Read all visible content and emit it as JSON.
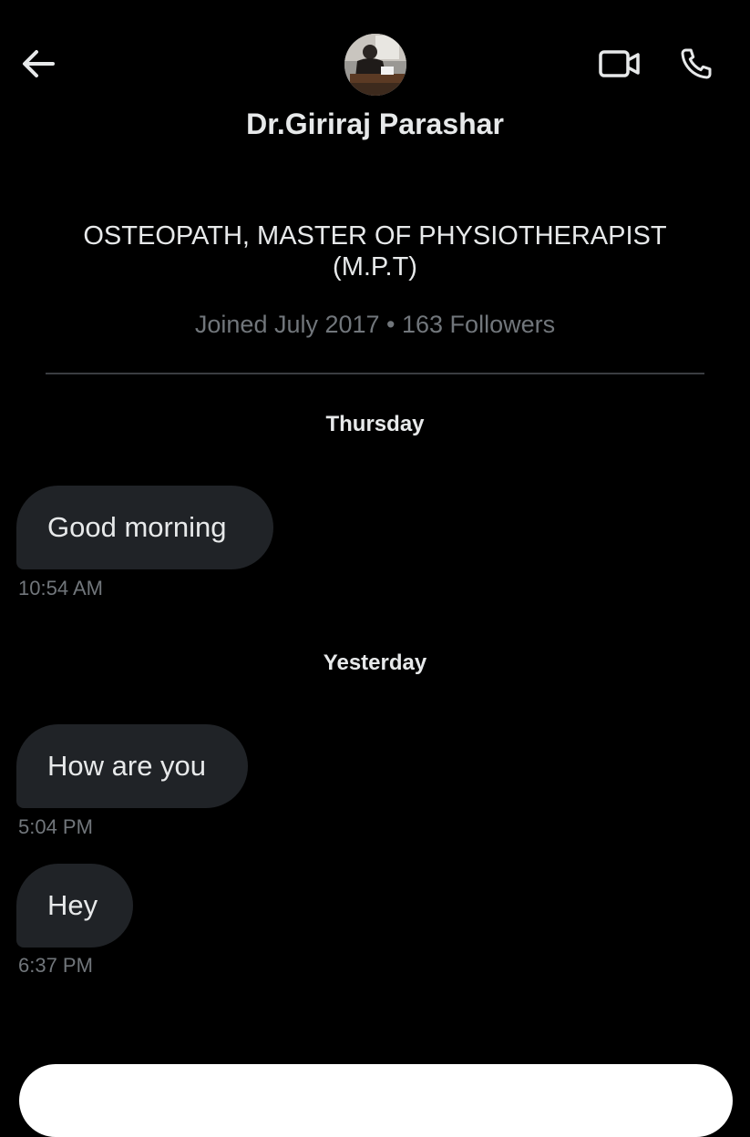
{
  "header": {
    "back_icon": "arrow-left-icon",
    "video_icon": "video-camera-icon",
    "call_icon": "phone-icon",
    "name": "Dr.Giriraj Parashar"
  },
  "profile": {
    "bio_line1": "OSTEOPATH, MASTER OF PHYSIOTHERAPIST",
    "bio_line2": "(M.P.T)",
    "meta": "Joined July 2017 • 163 Followers"
  },
  "conversation": {
    "groups": [
      {
        "day": "Thursday",
        "messages": [
          {
            "text": "Good morning",
            "time": "10:54 AM"
          }
        ]
      },
      {
        "day": "Yesterday",
        "messages": [
          {
            "text": "How are you",
            "time": "5:04 PM"
          },
          {
            "text": "Hey",
            "time": "6:37 PM"
          }
        ]
      }
    ]
  },
  "colors": {
    "background": "#000000",
    "bubble": "#202327",
    "text": "#e7e9ea",
    "muted": "#71767b",
    "composer": "#ffffff"
  }
}
